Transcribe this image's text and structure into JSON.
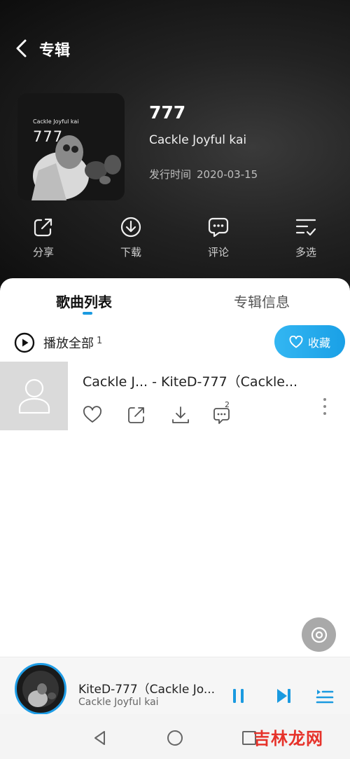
{
  "header": {
    "title": "专辑",
    "back_icon": "chevron-left-icon"
  },
  "album": {
    "cover_artist_text": "Cackle Joyful kai",
    "cover_number_text": "777",
    "name": "777",
    "artist": "Cackle Joyful kai",
    "release_label": "发行时间",
    "release_date": "2020-03-15"
  },
  "actions": [
    {
      "label": "分享",
      "icon": "share-icon"
    },
    {
      "label": "下载",
      "icon": "download-icon"
    },
    {
      "label": "评论",
      "icon": "comment-icon"
    },
    {
      "label": "多选",
      "icon": "multi-select-icon"
    }
  ],
  "tabs": [
    {
      "label": "歌曲列表",
      "active": true
    },
    {
      "label": "专辑信息",
      "active": false
    }
  ],
  "play_all": {
    "label": "播放全部",
    "count": "1",
    "icon": "play-circle-icon"
  },
  "collect": {
    "label": "收藏",
    "icon": "heart-icon"
  },
  "songs": [
    {
      "title": "Cackle J... - KiteD-777（Cackle...",
      "comment_count": "2",
      "icons": [
        "heart-icon",
        "share-icon",
        "download-icon",
        "comment-icon",
        "more-icon"
      ]
    }
  ],
  "player": {
    "title": "KiteD-777（Cackle Jo...",
    "artist": "Cackle Joyful kai",
    "controls": [
      "pause-icon",
      "next-icon",
      "playlist-icon"
    ]
  },
  "watermark": "吉林龙网",
  "colors": {
    "accent": "#1a9ae0",
    "header_bg": "#1e1e1e",
    "watermark": "#e6322a"
  }
}
